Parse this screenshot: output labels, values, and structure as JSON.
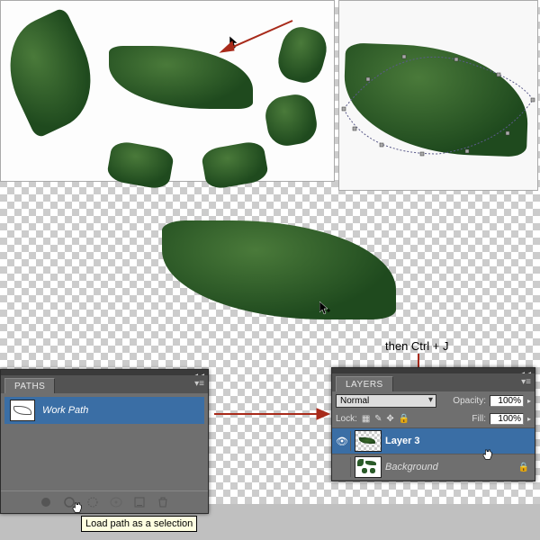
{
  "annotation": {
    "ctrl_j": "then Ctrl + J"
  },
  "paths_panel": {
    "tab": "PATHS",
    "item_name": "Work Path",
    "tooltip": "Load path as a selection"
  },
  "layers_panel": {
    "tab": "LAYERS",
    "blend_mode": "Normal",
    "opacity_label": "Opacity:",
    "opacity_value": "100%",
    "lock_label": "Lock:",
    "fill_label": "Fill:",
    "fill_value": "100%",
    "layers": [
      {
        "name": "Layer 3",
        "selected": true
      },
      {
        "name": "Background",
        "selected": false
      }
    ]
  }
}
